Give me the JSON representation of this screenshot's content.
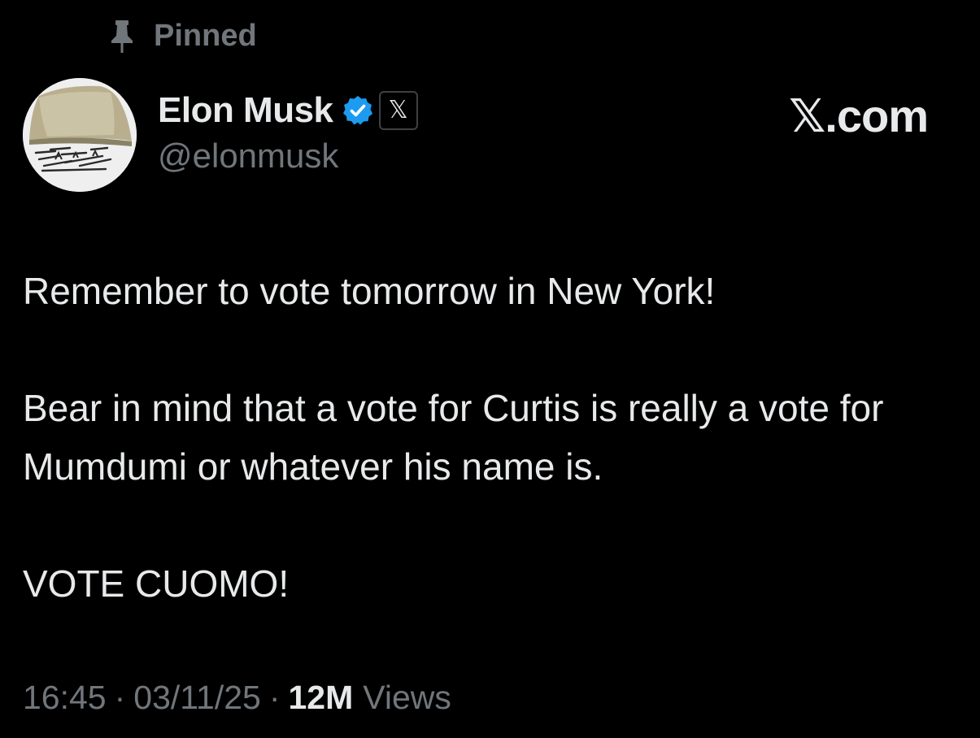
{
  "pinned": {
    "icon": "pin-icon",
    "label": "Pinned"
  },
  "author": {
    "avatar_icon": "avatar",
    "name": "Elon Musk",
    "verified_icon": "verified-badge-icon",
    "verified_color": "#1d9bf0",
    "affiliate_badge": "𝕏",
    "handle": "@elonmusk"
  },
  "watermark": "𝕏.com",
  "tweet": {
    "paragraphs": [
      "Remember to vote tomorrow in New York!",
      "Bear in mind that a vote for Curtis is really a vote for Mumdumi or whatever his name is.",
      "VOTE CUOMO!"
    ]
  },
  "meta": {
    "time": "16:45",
    "separator": "·",
    "date": "03/11/25",
    "views_count": "12M",
    "views_label": "Views"
  },
  "colors": {
    "background": "#000000",
    "text_primary": "#e7e9ea",
    "text_secondary": "#71767b"
  }
}
